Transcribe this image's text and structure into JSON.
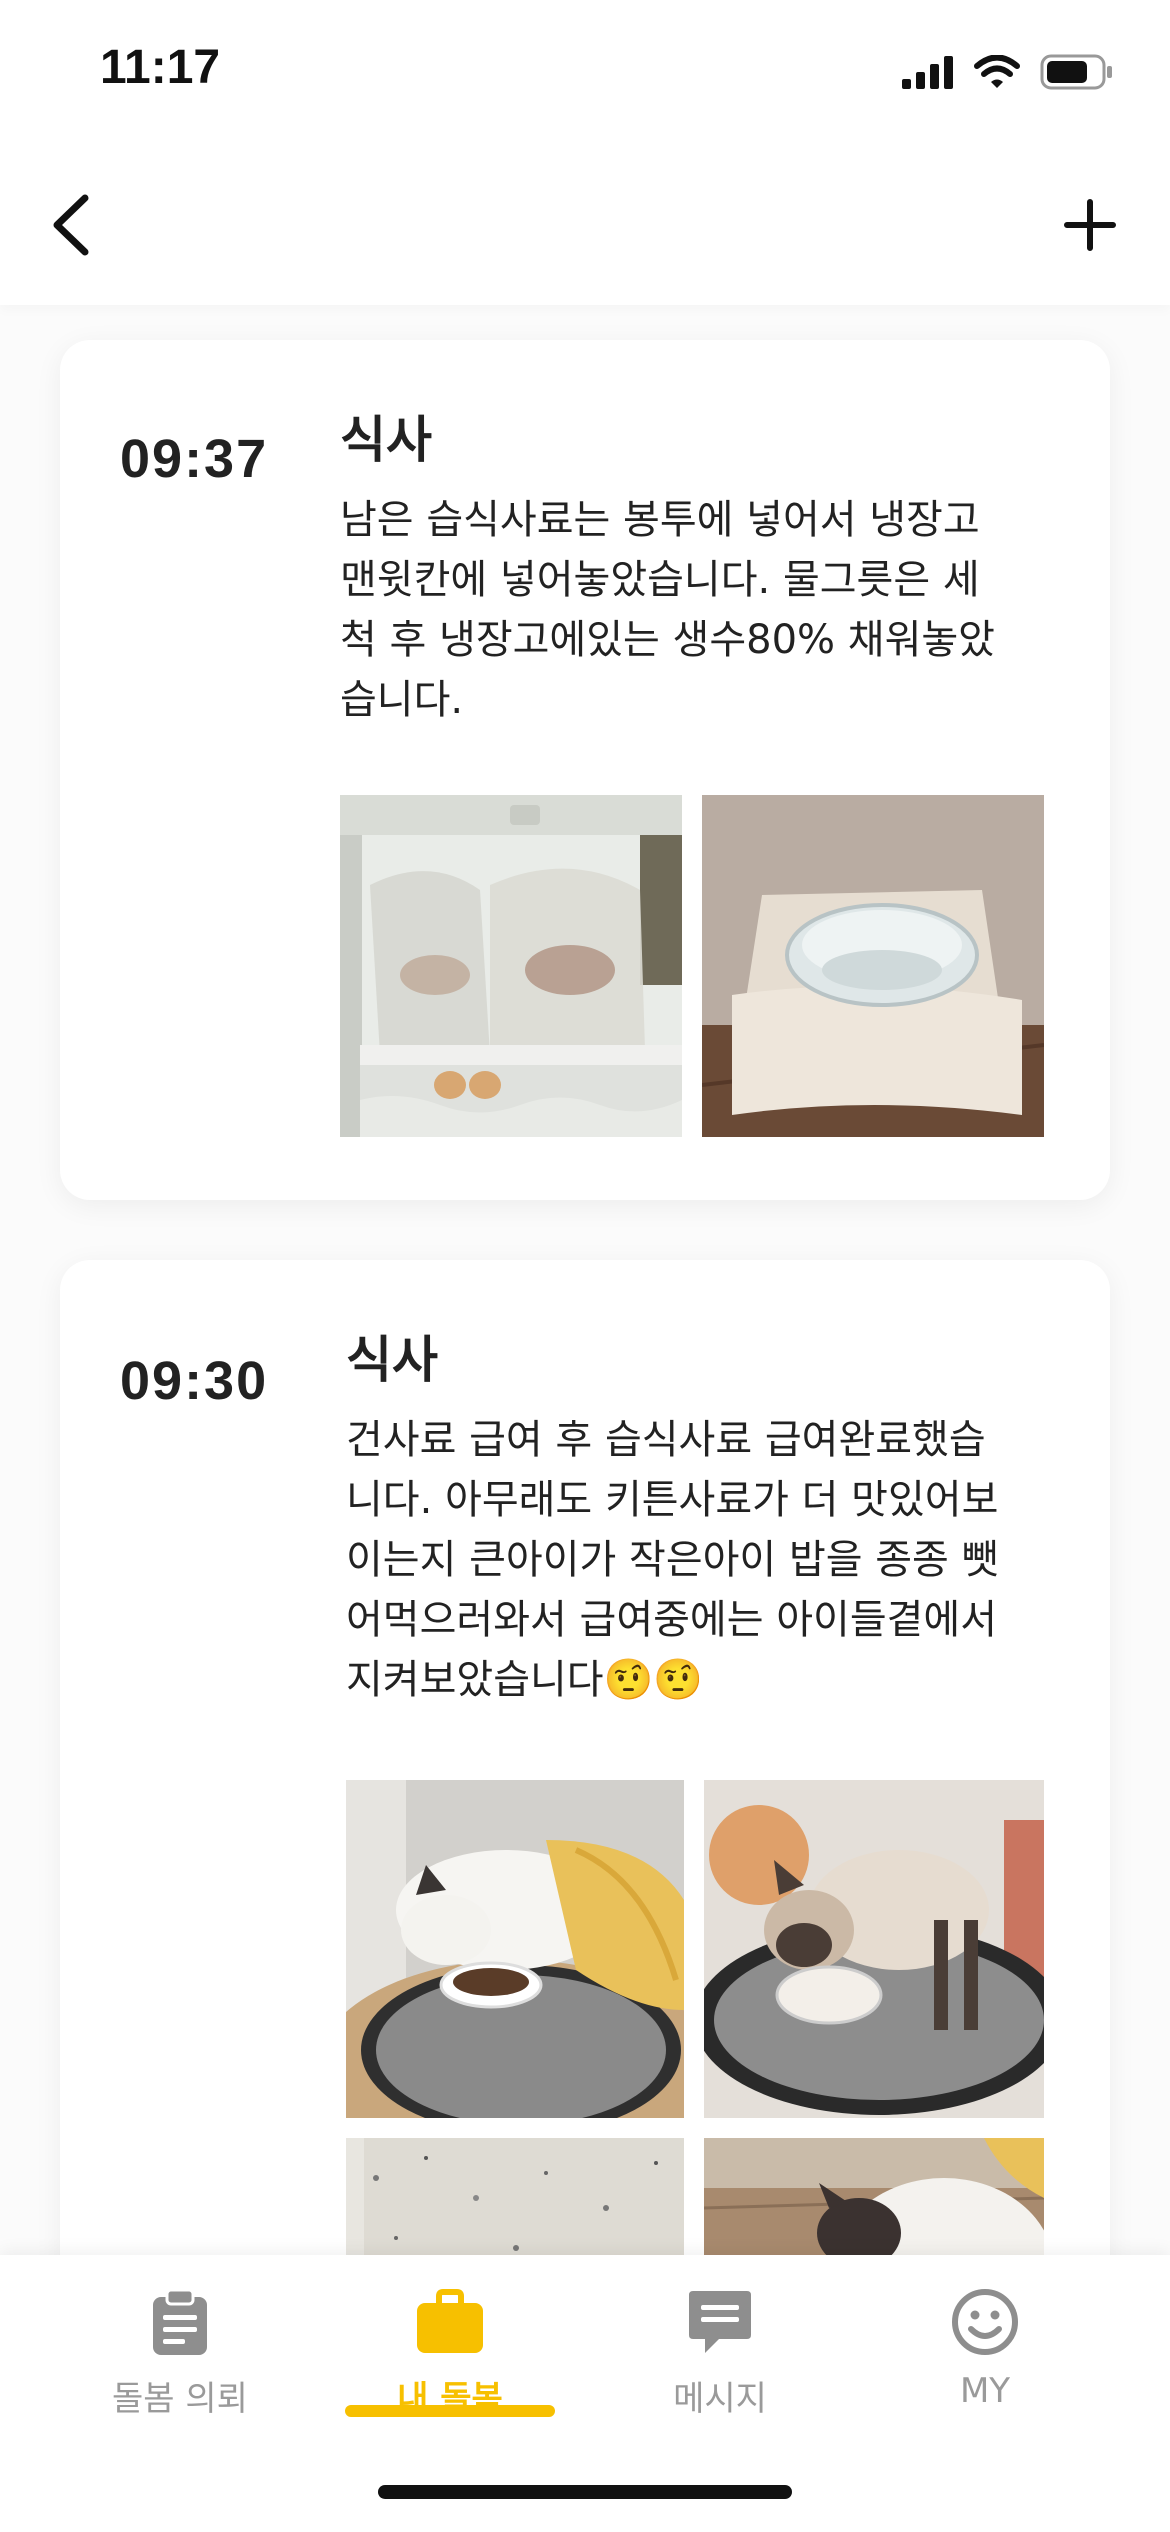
{
  "status_bar": {
    "time": "11:17",
    "icons": [
      "signal-icon",
      "wifi-icon",
      "battery-icon"
    ]
  },
  "nav": {
    "back_icon": "chevron-left-icon",
    "add_icon": "plus-icon"
  },
  "entries": [
    {
      "time": "09:37",
      "title": "식사",
      "description": "남은 습식사료는 봉투에 넣어서 냉장고\n맨윗칸에 넣어놓았습니다. 물그릇은 세\n척 후 냉장고에있는 생수80% 채워놓았\n습니다.",
      "photos": [
        "fridge-bags-photo",
        "water-bowl-photo"
      ]
    },
    {
      "time": "09:30",
      "title": "식사",
      "description": "건사료 급여 후 습식사료 급여완료했습\n니다. 아무래도 키튼사료가 더 맛있어보\n이는지 큰아이가 작은아이 밥을 종종 뺏\n어먹으러와서 급여중에는 아이들곁에서\n지켜보았습니다🤨🤨",
      "photos": [
        "cat-eating-photo-1",
        "cat-eating-photo-2",
        "floor-photo",
        "cat-photo-3"
      ]
    }
  ],
  "tabs": [
    {
      "label": "돌봄 의뢰",
      "icon": "clipboard-icon",
      "active": false
    },
    {
      "label": "내 돌봄",
      "icon": "briefcase-icon",
      "active": true
    },
    {
      "label": "메시지",
      "icon": "message-icon",
      "active": false
    },
    {
      "label": "MY",
      "icon": "smiley-icon",
      "active": false
    }
  ],
  "colors": {
    "accent": "#f7c000",
    "inactive": "#9a9a9a",
    "background": "#fbfbfb"
  }
}
